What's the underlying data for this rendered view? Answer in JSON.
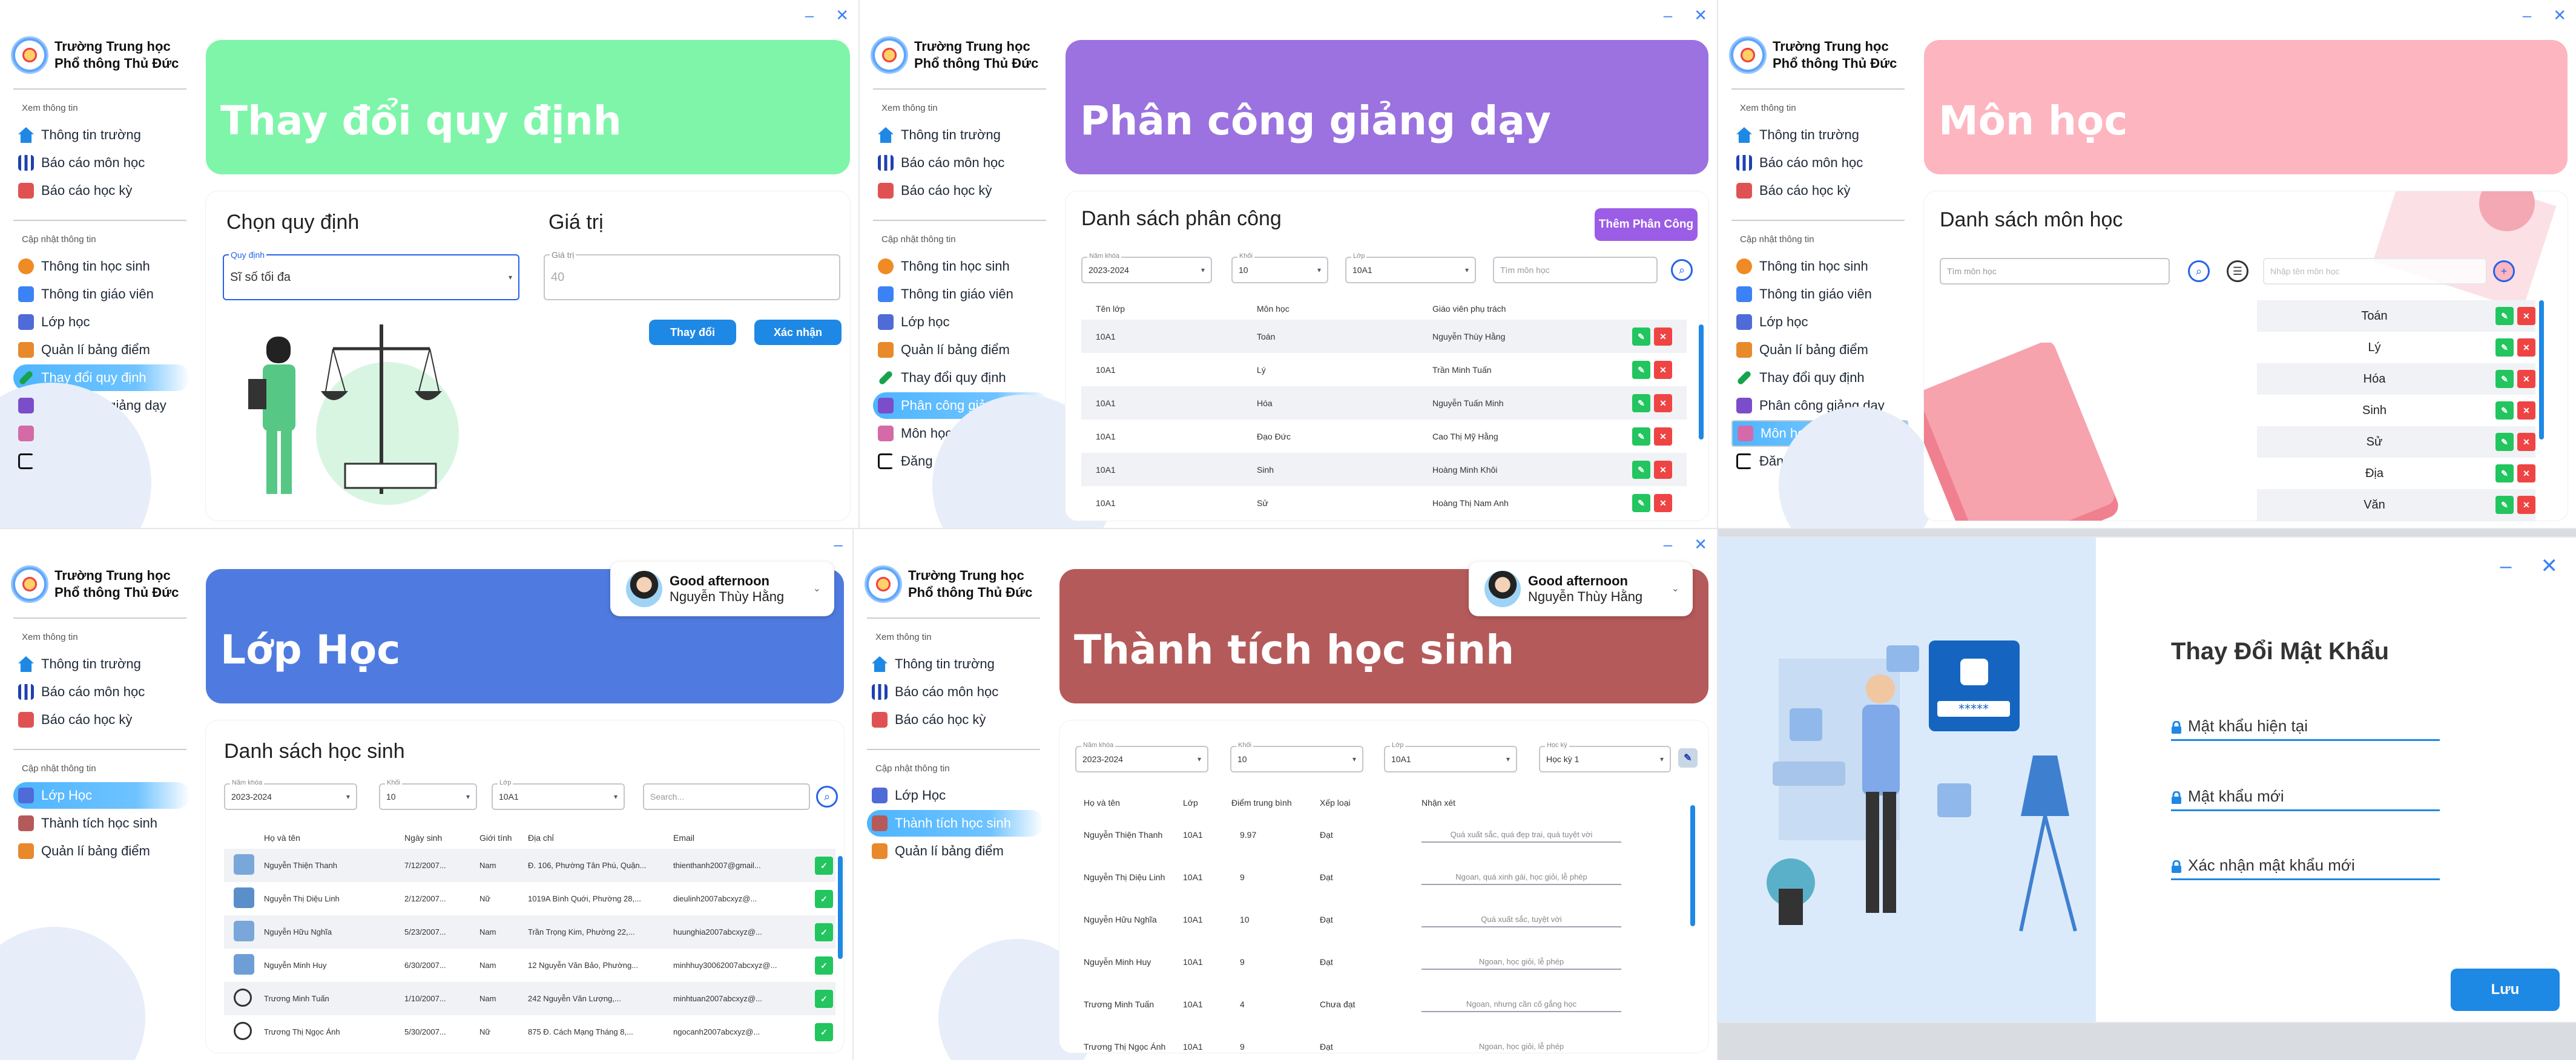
{
  "school": {
    "name_line1": "Trường Trung học",
    "name_line2": "Phổ thông Thủ Đức"
  },
  "window_controls": {
    "minimize": "–",
    "close": "✕"
  },
  "admin_sidebar": {
    "view_header": "Xem thông tin",
    "update_header": "Cập nhật thông tin",
    "view_items": [
      "Thông tin trường",
      "Báo cáo môn học",
      "Báo cáo học kỳ"
    ],
    "update_items": [
      "Thông tin học sinh",
      "Thông tin giáo viên",
      "Lớp học",
      "Quản lí bảng điểm",
      "Thay đổi quy định",
      "Phân công giảng dạy",
      "Môn học",
      "Đăng xuất"
    ]
  },
  "teacher_sidebar": {
    "view_header": "Xem thông tin",
    "update_header": "Cập nhật thông tin",
    "view_items": [
      "Thông tin trường",
      "Báo cáo môn học",
      "Báo cáo học kỳ"
    ],
    "update_items": [
      "Lớp Học",
      "Thành tích học sinh",
      "Quản lí bảng điểm"
    ]
  },
  "teacher_sidebar_b": {
    "update_items": [
      "Lớp Học",
      "Thành tích học sinh",
      "Quản lí bảng điểm"
    ]
  },
  "rules": {
    "banner_title": "Thay đổi quy định",
    "banner_color": "#7ef5a9",
    "choose_label": "Chọn quy định",
    "value_label": "Giá trị",
    "rule_field_label": "Quy định",
    "rule_value": "Sĩ số tối đa",
    "value_field_label": "Giá trị",
    "value_placeholder": "40",
    "change_button": "Thay đổi",
    "confirm_button": "Xác nhận"
  },
  "assign": {
    "banner_title": "Phân công giảng dạy",
    "banner_color": "#9b72e0",
    "list_title": "Danh sách phân công",
    "add_button": "Thêm Phân Công",
    "filters": {
      "year_label": "Năm khóa",
      "year": "2023-2024",
      "grade_label": "Khối",
      "grade": "10",
      "class_label": "Lớp",
      "class": "10A1",
      "search_placeholder": "Tìm môn học"
    },
    "columns": [
      "Tên lớp",
      "Môn học",
      "Giáo viên phụ trách"
    ],
    "rows": [
      [
        "10A1",
        "Toán",
        "Nguyễn Thùy Hằng"
      ],
      [
        "10A1",
        "Lý",
        "Trần Minh Tuấn"
      ],
      [
        "10A1",
        "Hóa",
        "Nguyễn Tuấn Minh"
      ],
      [
        "10A1",
        "Đạo Đức",
        "Cao Thị Mỹ Hằng"
      ],
      [
        "10A1",
        "Sinh",
        "Hoàng Minh Khôi"
      ],
      [
        "10A1",
        "Sử",
        "Hoàng Thị Nam Anh"
      ]
    ]
  },
  "subjects": {
    "banner_title": "Môn học",
    "banner_color": "#fdb5c0",
    "list_title": "Danh sách môn học",
    "search_placeholder": "Tìm môn học",
    "new_placeholder": "Nhập tên môn học",
    "add_icon": "+",
    "items": [
      "Toán",
      "Lý",
      "Hóa",
      "Sinh",
      "Sử",
      "Địa",
      "Văn"
    ]
  },
  "classes": {
    "banner_title": "Lớp Học",
    "banner_color": "#4f7be0",
    "list_title": "Danh sách học sinh",
    "filters": {
      "year_label": "Năm khóa",
      "year": "2023-2024",
      "grade_label": "Khối",
      "grade": "10",
      "class_label": "Lớp",
      "class": "10A1",
      "search_placeholder": "Search..."
    },
    "columns": [
      "Họ và tên",
      "Ngày sinh",
      "Giới tính",
      "Địa chỉ",
      "Email"
    ],
    "rows": [
      [
        "Nguyễn Thiện Thanh",
        "7/12/2007...",
        "Nam",
        "Đ. 106, Phường Tân Phú, Quận...",
        "thienthanh2007@gmail..."
      ],
      [
        "Nguyễn Thị Diệu Linh",
        "2/12/2007...",
        "Nữ",
        "1019A Bình Quới, Phường 28,...",
        "dieulinh2007abcxyz@..."
      ],
      [
        "Nguyễn Hữu Nghĩa",
        "5/23/2007...",
        "Nam",
        "Trần Trọng Kim, Phường 22,...",
        "huunghia2007abcxyz@..."
      ],
      [
        "Nguyễn Minh Huy",
        "6/30/2007...",
        "Nam",
        "12 Nguyễn Văn Bảo, Phường...",
        "minhhuy30062007abcxyz@..."
      ],
      [
        "Trương Minh Tuấn",
        "1/10/2007...",
        "Nam",
        "242 Nguyễn Văn Lượng,...",
        "minhtuan2007abcxyz@..."
      ],
      [
        "Trương Thị Ngọc Ánh",
        "5/30/2007...",
        "Nữ",
        "875 Đ. Cách Mạng Tháng 8,...",
        "ngocanh2007abcxyz@..."
      ]
    ]
  },
  "achievement": {
    "banner_title": "Thành tích học sinh",
    "banner_color": "#b55a5a",
    "filters": {
      "year_label": "Năm khóa",
      "year": "2023-2024",
      "grade_label": "Khối",
      "grade": "10",
      "class_label": "Lớp",
      "class": "10A1",
      "term_label": "Học kỳ",
      "term": "Học kỳ 1"
    },
    "columns": [
      "Họ và tên",
      "Lớp",
      "Điểm trung bình",
      "Xếp loại",
      "Nhận xét"
    ],
    "rows": [
      [
        "Nguyễn Thiện Thanh",
        "10A1",
        "9.97",
        "Đạt",
        "Quá xuất sắc, quá đẹp trai, quá tuyệt vời"
      ],
      [
        "Nguyễn Thị Diệu Linh",
        "10A1",
        "9",
        "Đạt",
        "Ngoan, quá xinh gái, học giỏi, lễ phép"
      ],
      [
        "Nguyễn Hữu Nghĩa",
        "10A1",
        "10",
        "Đạt",
        "Quá xuất sắc, tuyệt vời"
      ],
      [
        "Nguyễn Minh Huy",
        "10A1",
        "9",
        "Đạt",
        "Ngoan, học giỏi, lễ phép"
      ],
      [
        "Trương Minh Tuấn",
        "10A1",
        "4",
        "Chưa đạt",
        "Ngoan, nhưng cần cố gắng học"
      ],
      [
        "Trương Thị Ngọc Ánh",
        "10A1",
        "9",
        "Đạt",
        "Ngoan, học giỏi, lễ phép"
      ]
    ]
  },
  "greeting": {
    "hello": "Good afternoon",
    "user": "Nguyễn Thùy Hằng"
  },
  "password": {
    "title": "Thay Đổi Mật Khẩu",
    "current": "Mật khẩu hiện tại",
    "new": "Mật khẩu mới",
    "confirm": "Xác nhận mật khẩu mới",
    "save_button": "Lưu",
    "pin_display": "*****"
  },
  "colors": {
    "accent": "#1e88e5",
    "ok": "#22c55e",
    "danger": "#ef4444"
  }
}
